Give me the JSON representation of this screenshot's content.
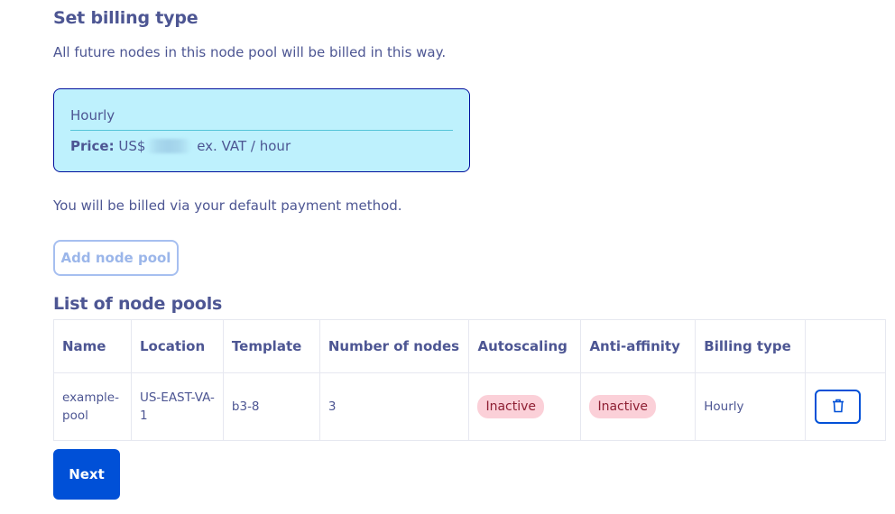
{
  "billing": {
    "title": "Set billing type",
    "subtitle": "All future nodes in this node pool will be billed in this way.",
    "card": {
      "plan": "Hourly",
      "price_label": "Price:",
      "currency": "US$",
      "price_suffix": "ex. VAT / hour"
    },
    "payment_note": "You will be billed via your default payment method."
  },
  "add_pool_label": "Add node pool",
  "list": {
    "title": "List of node pools",
    "columns": [
      "Name",
      "Location",
      "Template",
      "Number of nodes",
      "Autoscaling",
      "Anti-affinity",
      "Billing type"
    ],
    "rows": [
      {
        "name": "example-pool",
        "location": "US-EAST-VA-1",
        "template": "b3-8",
        "nodes": "3",
        "autoscaling": "Inactive",
        "anti_affinity": "Inactive",
        "billing_type": "Hourly"
      }
    ]
  },
  "next_label": "Next",
  "icons": {
    "delete": "trash-icon"
  },
  "colors": {
    "primary": "#0050d7",
    "heading": "#4d5693",
    "card_bg": "#bef1fd",
    "badge_bg": "#fbd0d8"
  }
}
